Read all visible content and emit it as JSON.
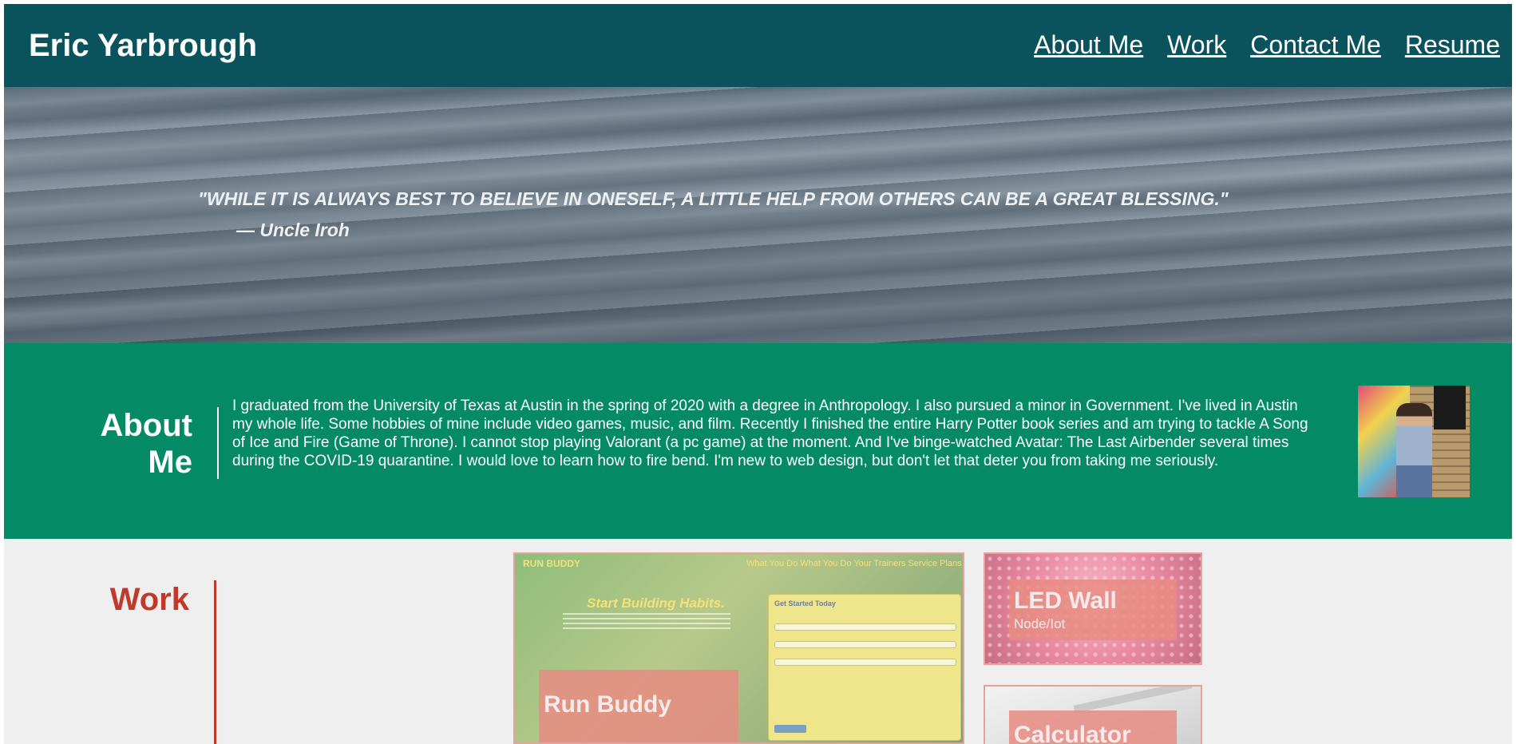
{
  "header": {
    "title": "Eric Yarbrough",
    "nav": [
      "About Me",
      "Work",
      "Contact Me",
      "Resume"
    ]
  },
  "hero": {
    "quote": "\"WHILE IT IS ALWAYS BEST TO BELIEVE IN ONESELF, A LITTLE HELP FROM OTHERS CAN BE A GREAT BLESSING.\"",
    "author": "— Uncle Iroh"
  },
  "about": {
    "title_line1": "About",
    "title_line2": "Me",
    "text": "I graduated from the University of Texas at Austin in the spring of 2020 with a degree in Anthropology. I also pursued a minor in Government. I've lived in Austin my whole life. Some hobbies of mine include video games, music, and film. Recently I finished the entire Harry Potter book series and am trying to tackle A Song of Ice and Fire (Game of Throne). I cannot stop playing Valorant (a pc game) at the moment. And I've binge-watched Avatar: The Last Airbender several times during the COVID-19 quarantine. I would love to learn how to fire bend. I'm new to web design, but don't let that deter you from taking me seriously."
  },
  "work": {
    "title": "Work",
    "projects": [
      {
        "title": "Run Buddy",
        "preview": {
          "brand": "RUN BUDDY",
          "nav": "What You Do   What You Do   Your Trainers   Service Plans",
          "headline": "Start Building Habits.",
          "form_title": "Get Started Today"
        }
      },
      {
        "title": "LED Wall",
        "subtitle": "Node/Iot"
      },
      {
        "title": "Calculator"
      }
    ]
  },
  "colors": {
    "header_bg": "#0b535c",
    "about_bg": "#048a64",
    "work_bg": "#efefef",
    "work_accent": "#c0392b"
  }
}
